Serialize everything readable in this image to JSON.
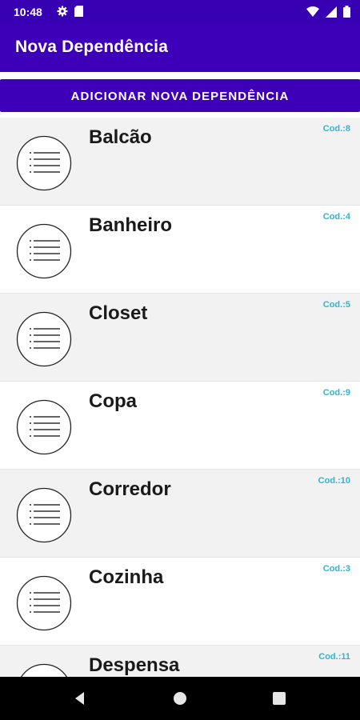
{
  "status_bar": {
    "time": "10:48",
    "icons_left": [
      "gear-icon",
      "sd-card-icon"
    ],
    "icons_right": [
      "wifi-icon",
      "signal-icon",
      "battery-icon"
    ]
  },
  "app_bar": {
    "title": "Nova Dependência"
  },
  "add_button": {
    "label": "ADICIONAR NOVA DEPENDÊNCIA"
  },
  "list": {
    "items": [
      {
        "name": "Balcão",
        "code": "Cod.:8"
      },
      {
        "name": "Banheiro",
        "code": "Cod.:4"
      },
      {
        "name": "Closet",
        "code": "Cod.:5"
      },
      {
        "name": "Copa",
        "code": "Cod.:9"
      },
      {
        "name": "Corredor",
        "code": "Cod.:10"
      },
      {
        "name": "Cozinha",
        "code": "Cod.:3"
      },
      {
        "name": "Despensa",
        "code": "Cod.:11"
      }
    ]
  },
  "nav_bar": {
    "icons": [
      "back-icon",
      "home-icon",
      "recents-icon"
    ]
  },
  "colors": {
    "primary": "#3d00b8",
    "status": "#3700b3",
    "code_text": "#29b6d8",
    "alt_row": "#f2f2f2"
  }
}
